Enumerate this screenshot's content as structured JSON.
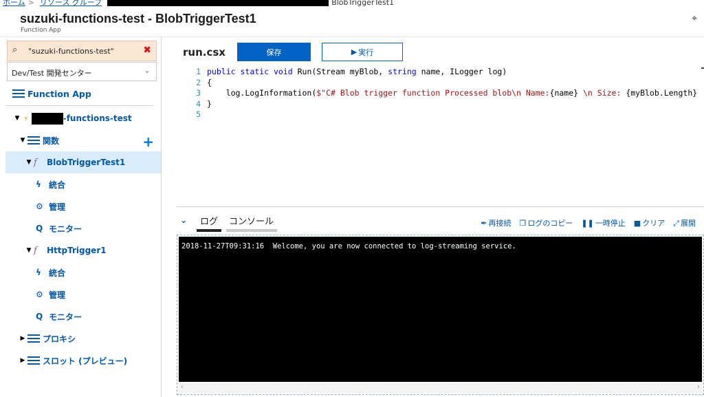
{
  "breadcrumb": {
    "home": "ホーム",
    "resource_group": "リソース グループ",
    "current": "BlobTriggerTest1"
  },
  "header": {
    "title": "suzuki-functions-test - BlobTriggerTest1",
    "subtitle": "Function App"
  },
  "sidebar": {
    "search_value": "\"suzuki-functions-test\"",
    "subscription_select": "Dev/Test 開発センター",
    "function_app_link": "Function App",
    "tree": {
      "app_name_suffix": "-functions-test",
      "functions_label": "関数",
      "functions": [
        {
          "name": "BlobTriggerTest1",
          "children": [
            "統合",
            "管理",
            "モニター"
          ]
        },
        {
          "name": "HttpTrigger1",
          "children": [
            "統合",
            "管理",
            "モニター"
          ]
        }
      ],
      "proxies_label": "プロキシ",
      "slots_label": "スロット (プレビュー)"
    }
  },
  "editor": {
    "file_name": "run.csx",
    "save_label": "保存",
    "run_label": "実行",
    "lines": [
      {
        "num": "1"
      },
      {
        "num": "2",
        "text": "{"
      },
      {
        "num": "3"
      },
      {
        "num": "4",
        "text": "}"
      },
      {
        "num": "5",
        "text": ""
      }
    ],
    "line1": {
      "kw1": "public",
      "kw2": "static",
      "kw3": "void",
      "rest1": " Run(Stream myBlob, ",
      "kw4": "string",
      "rest2": " name, ILogger log)"
    },
    "line3": {
      "pre": "    log.LogInformation(",
      "str": "$\"C# Blob trigger function Processed blob\\n Name:",
      "mid1": "{name}",
      "str2": " \\n Size: ",
      "mid2": "{myBlob.Length}",
      "end": ""
    }
  },
  "logs": {
    "tab_log": "ログ",
    "tab_console": "コンソール",
    "actions": {
      "reconnect": "再接続",
      "copy": "ログのコピー",
      "pause": "一時停止",
      "clear": "クリア",
      "expand": "展開"
    },
    "console_line": "2018-11-27T09:31:16  Welcome, you are now connected to log-streaming service."
  }
}
